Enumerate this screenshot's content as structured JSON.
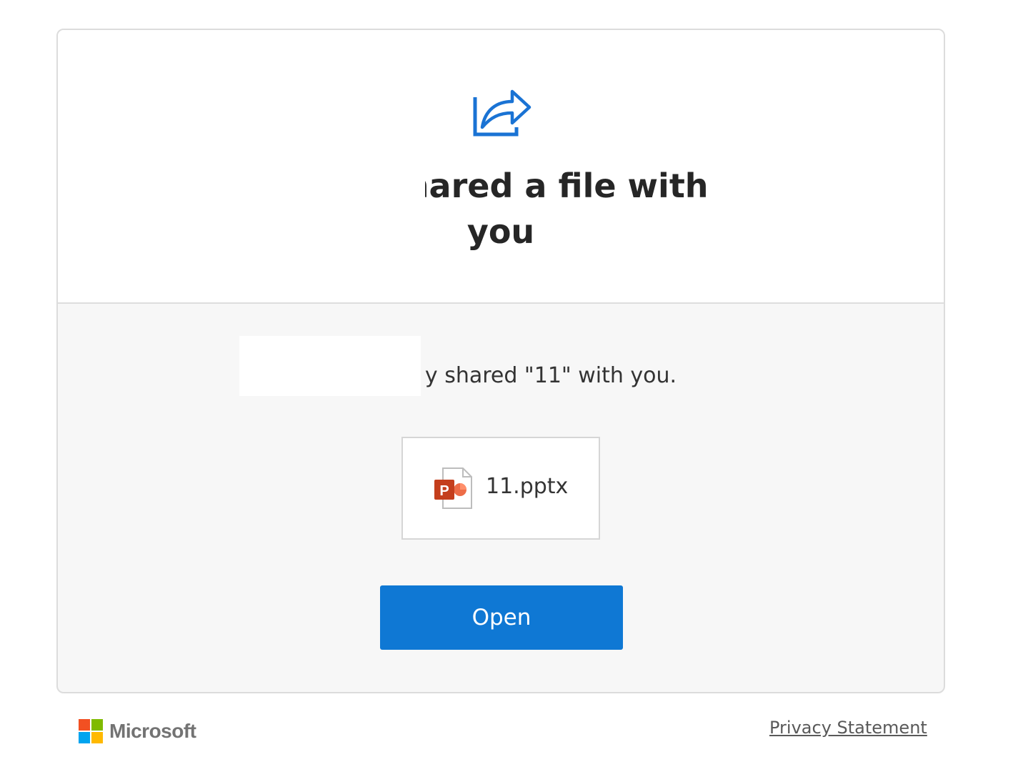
{
  "header": {
    "share_icon": "share-arrow-icon",
    "heading_line1": "y shared a file with",
    "heading_line2": "you"
  },
  "body": {
    "message": "y shared \"11\" with you.",
    "file": {
      "icon": "powerpoint-file-icon",
      "name": "11.pptx"
    },
    "open_label": "Open"
  },
  "footer": {
    "brand": "Microsoft",
    "privacy_label": "Privacy Statement"
  },
  "colors": {
    "accent": "#0f78d4",
    "powerpoint": "#c43e1c"
  }
}
